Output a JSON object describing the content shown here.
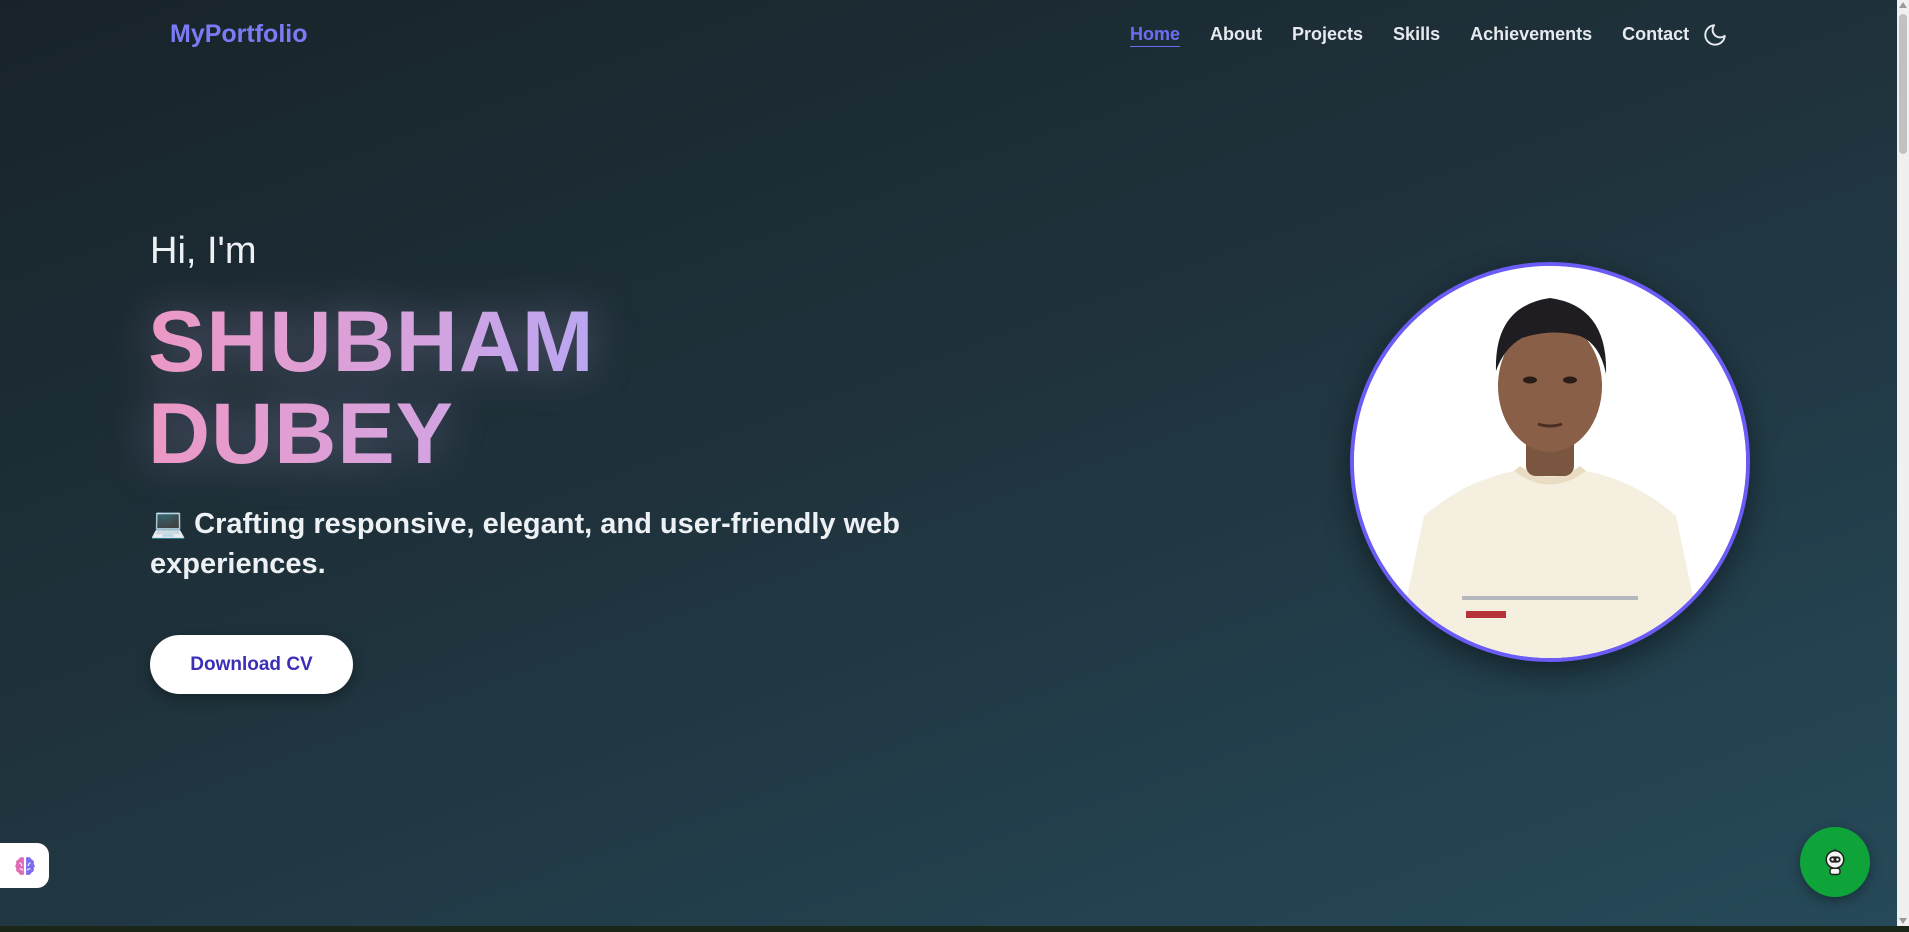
{
  "header": {
    "logo": "MyPortfolio",
    "nav": [
      {
        "label": "Home",
        "active": true
      },
      {
        "label": "About",
        "active": false
      },
      {
        "label": "Projects",
        "active": false
      },
      {
        "label": "Skills",
        "active": false
      },
      {
        "label": "Achievements",
        "active": false
      },
      {
        "label": "Contact",
        "active": false
      }
    ],
    "theme_toggle_icon": "moon-icon"
  },
  "hero": {
    "greeting": "Hi, I'm",
    "name_line1": "SHUBHAM",
    "name_line2": "DUBEY",
    "tagline": "💻 Crafting responsive, elegant, and user-friendly web experiences.",
    "cta_label": "Download CV",
    "avatar_icon": "profile-photo"
  },
  "widgets": {
    "brain_icon": "brain-icon",
    "chat_icon": "robot-chat-icon"
  },
  "colors": {
    "accent": "#6d6df2",
    "avatar_border": "#6a5cf5",
    "chat_button": "#0ea43a",
    "name_gradient_start": "#ec98c5",
    "name_gradient_end": "#b9a6f2"
  }
}
